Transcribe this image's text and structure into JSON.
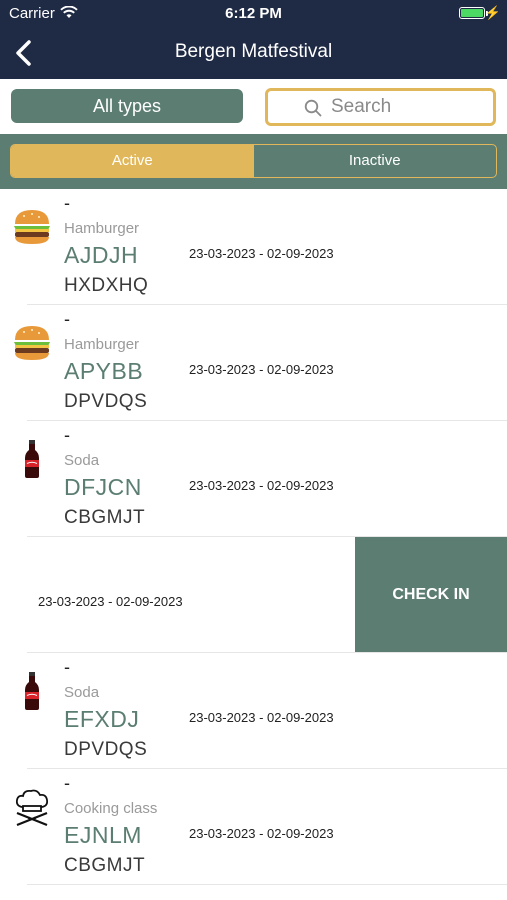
{
  "status": {
    "carrier": "Carrier",
    "time": "6:12 PM"
  },
  "nav": {
    "title": "Bergen Matfestival"
  },
  "filter": {
    "type_label": "All types",
    "search_placeholder": "Search"
  },
  "segments": {
    "active": "Active",
    "inactive": "Inactive"
  },
  "rows": [
    {
      "icon": "hamburger-icon",
      "dash": "-",
      "type": "Hamburger",
      "code": "AJDJH",
      "sub": "HXDXHQ",
      "date": "23-03-2023 - 02-09-2023"
    },
    {
      "icon": "hamburger-icon",
      "dash": "-",
      "type": "Hamburger",
      "code": "APYBB",
      "sub": "DPVDQS",
      "date": "23-03-2023 - 02-09-2023"
    },
    {
      "icon": "soda-bottle-icon",
      "dash": "-",
      "type": "Soda",
      "code": "DFJCN",
      "sub": "CBGMJT",
      "date": "23-03-2023 - 02-09-2023"
    },
    {
      "icon": "soda-bottle-icon",
      "dash": "-",
      "type": "Soda",
      "code": "EFXDJ",
      "sub": "DPVDQS",
      "date": "23-03-2023 - 02-09-2023"
    },
    {
      "icon": "chef-hat-icon",
      "dash": "-",
      "type": "Cooking class",
      "code": "EJNLM",
      "sub": "CBGMJT",
      "date": "23-03-2023 - 02-09-2023"
    }
  ],
  "swiped_row": {
    "date": "23-03-2023 - 02-09-2023",
    "action": "CHECK IN"
  },
  "colors": {
    "navy": "#1f2a44",
    "accent_green": "#5b7d72",
    "accent_gold": "#e0b75a"
  }
}
